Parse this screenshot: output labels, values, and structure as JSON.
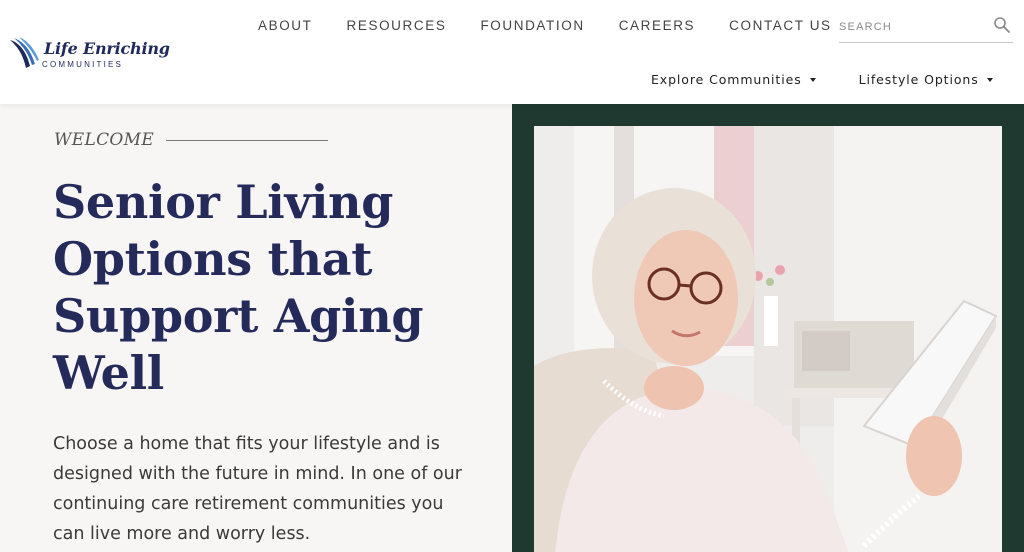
{
  "brand": {
    "name": "Life Enriching",
    "sub": "COMMUNITIES",
    "logo_icon": "swoosh-logo-icon",
    "color_navy": "#1f2a5c"
  },
  "nav": {
    "items": [
      {
        "label": "ABOUT"
      },
      {
        "label": "RESOURCES"
      },
      {
        "label": "FOUNDATION"
      },
      {
        "label": "CAREERS"
      },
      {
        "label": "CONTACT US"
      }
    ]
  },
  "search": {
    "placeholder": "SEARCH",
    "value": "",
    "icon": "search-icon"
  },
  "subnav": {
    "items": [
      {
        "label": "Explore Communities",
        "icon": "caret-down-icon"
      },
      {
        "label": "Lifestyle Options",
        "icon": "caret-down-icon"
      }
    ]
  },
  "hero": {
    "eyebrow": "WELCOME",
    "title": "Senior Living Options that Support Aging Well",
    "body": "Choose a home that fits your lifestyle and is designed with the future in mind. In one of our continuing care retirement communities you can live more and worry less.",
    "title_color": "#242b5b",
    "panel_color": "#1f3830"
  }
}
